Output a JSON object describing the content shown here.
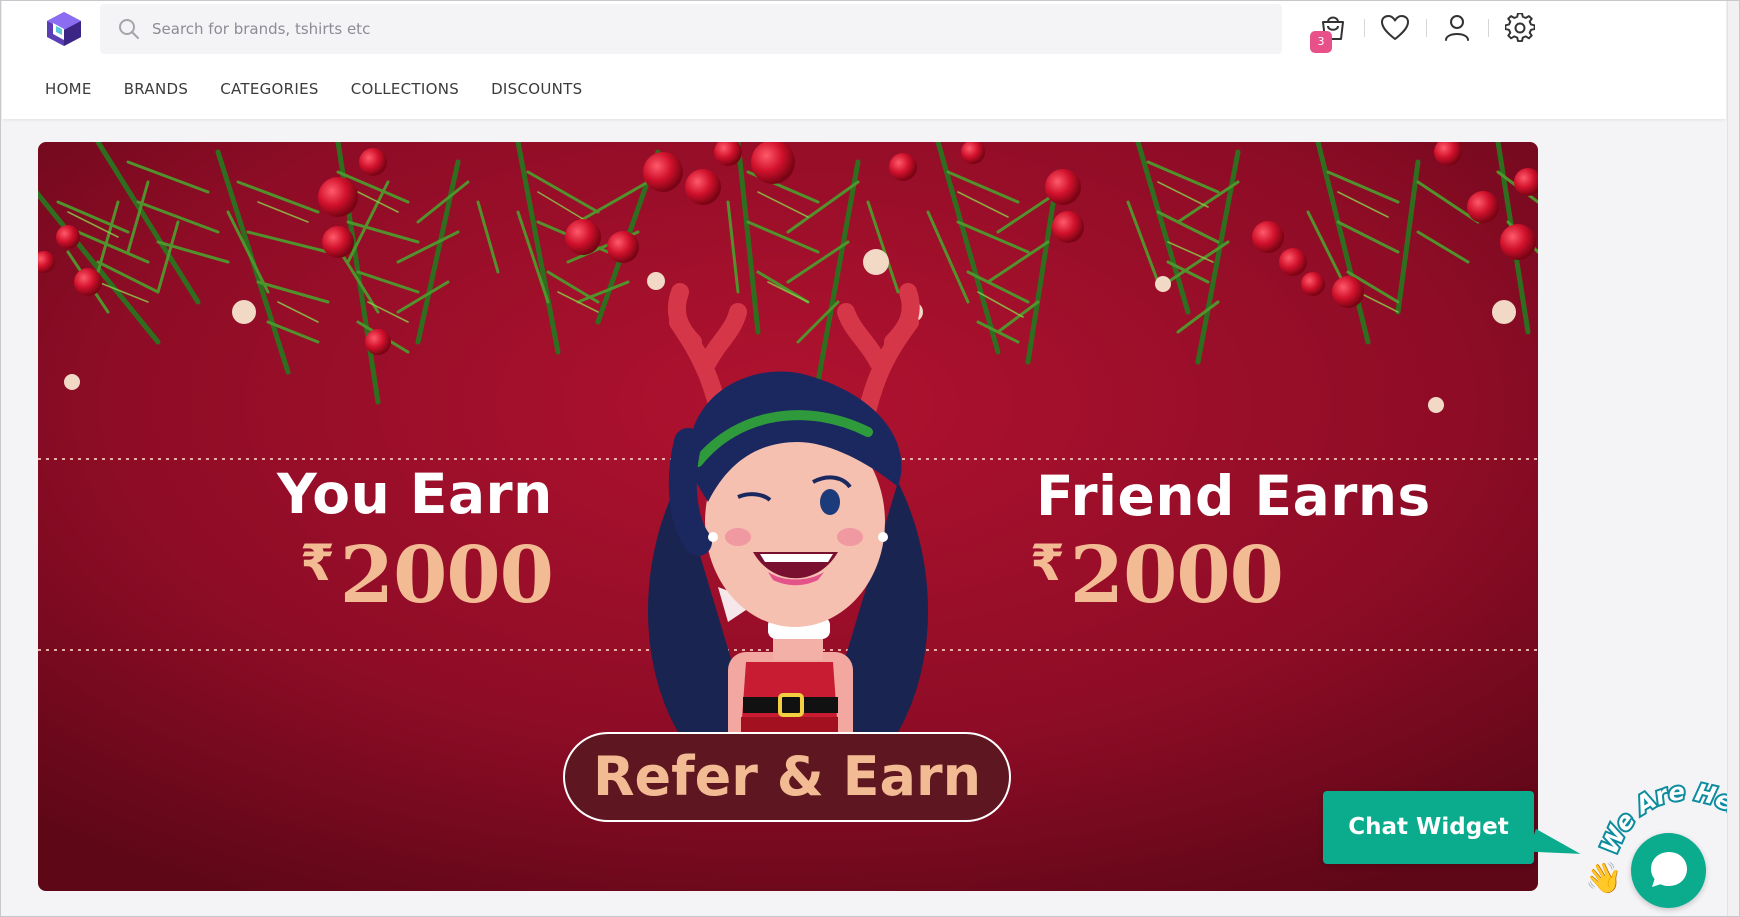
{
  "search": {
    "placeholder": "Search for brands, tshirts etc"
  },
  "cart": {
    "badge": "3"
  },
  "nav": [
    "HOME",
    "BRANDS",
    "CATEGORIES",
    "COLLECTIONS",
    "DISCOUNTS"
  ],
  "banner": {
    "you_earn": "You Earn",
    "you_amount": "2000",
    "friend_earns": "Friend Earns",
    "friend_amount": "2000",
    "currency": "₹",
    "cta": "Refer & Earn"
  },
  "chat": {
    "label": "Chat Widget",
    "tagline": "We Are Here!"
  },
  "colors": {
    "accent": "#0bab8e",
    "badge": "#e8508a",
    "banner_red": "#9a0d2a",
    "amount_peach": "#f3bb93"
  }
}
